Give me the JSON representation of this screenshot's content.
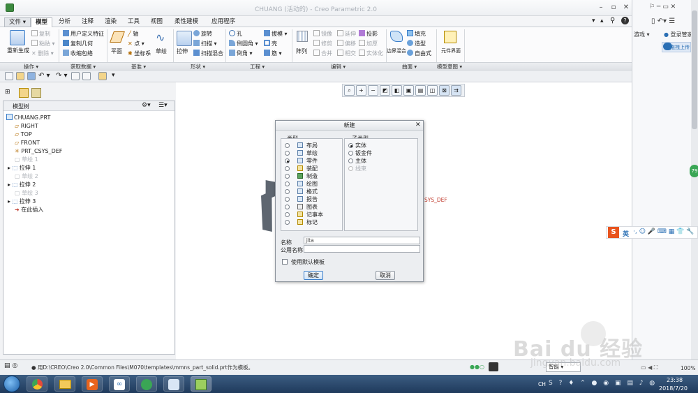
{
  "window": {
    "title": "CHUANG (活动的) - Creo Parametric 2.0"
  },
  "menu": {
    "file": "文件",
    "tabs": [
      "模型",
      "分析",
      "注释",
      "渲染",
      "工具",
      "视图",
      "柔性建模",
      "应用程序"
    ]
  },
  "ribbon": {
    "regen": "重新生成",
    "copy": "复制",
    "paste": "粘贴",
    "delete": "删除",
    "udf": "用户定义特征",
    "copy_geom": "复制几何",
    "shrinkwrap": "收缩包络",
    "plane": "平面",
    "axis": "轴",
    "point": "点",
    "csys": "坐标系",
    "sketch": "草绘",
    "extrude": "拉伸",
    "revolve": "旋转",
    "sweep": "扫描",
    "swept_blend": "扫描混合",
    "hole": "孔",
    "round": "倒圆角",
    "chamfer": "倒角",
    "draft": "拔模",
    "shell": "壳",
    "rib": "筋",
    "pattern": "阵列",
    "mirror": "镜像",
    "trim": "修剪",
    "merge": "合并",
    "extend": "延伸",
    "offset": "偏移",
    "intersect": "相交",
    "project": "投影",
    "thicken": "加厚",
    "solidify": "实体化",
    "boundary_blend": "边界混合",
    "fill": "填充",
    "style": "造型",
    "freestyle": "自由式",
    "comp_interface": "元件界面",
    "groups": [
      "操作",
      "获取数据",
      "基准",
      "形状",
      "工程",
      "编辑",
      "曲面",
      "模型意图"
    ]
  },
  "tree": {
    "header": "模型树",
    "items": [
      {
        "label": "CHUANG.PRT",
        "state": "normal"
      },
      {
        "label": "RIGHT",
        "state": "normal"
      },
      {
        "label": "TOP",
        "state": "normal"
      },
      {
        "label": "FRONT",
        "state": "normal"
      },
      {
        "label": "PRT_CSYS_DEF",
        "state": "normal"
      },
      {
        "label": "草绘 1",
        "state": "dim"
      },
      {
        "label": "拉伸 1",
        "state": "normal"
      },
      {
        "label": "草绘 2",
        "state": "dim"
      },
      {
        "label": "拉伸 2",
        "state": "normal"
      },
      {
        "label": "草绘 3",
        "state": "dim"
      },
      {
        "label": "拉伸 3",
        "state": "normal"
      },
      {
        "label": "在此插入",
        "state": "normal"
      }
    ]
  },
  "canvas": {
    "csys_label": "SYS_DEF"
  },
  "dialog": {
    "title": "新建",
    "type_header": "类型",
    "subtype_header": "子类型",
    "types": [
      "布局",
      "草绘",
      "零件",
      "装配",
      "制造",
      "绘图",
      "格式",
      "报告",
      "图表",
      "记事本",
      "标记"
    ],
    "selected_type": "零件",
    "subtypes": [
      "实体",
      "钣金件",
      "主体",
      "线束"
    ],
    "selected_subtype": "实体",
    "name_label": "名称",
    "name_value": "jita",
    "common_name_label": "公用名称",
    "common_name_value": "",
    "default_template_label": "使用默认模板",
    "ok": "确定",
    "cancel": "取消"
  },
  "status": {
    "message": "● 用D:\\CREO\\Creo 2.0\\Common Files\\M070\\templates\\mmns_part_solid.prt作为模板。",
    "filter": "智能"
  },
  "browser": {
    "games": "游戏",
    "login": "登录管家",
    "badge": "拖拽上传"
  },
  "ime": {
    "lang": "英"
  },
  "taskbar": {
    "lang": "CH",
    "time": "23:38",
    "date": "2018/7/20",
    "zoom": "100%",
    "side_badge": "79"
  },
  "watermark": {
    "brand": "Bai du 经验",
    "url": "jingyan.baidu.com"
  },
  "colors": {
    "accent": "#2a6fb4",
    "taskbar": "#1f3a5c",
    "csys": "#c0392b"
  }
}
